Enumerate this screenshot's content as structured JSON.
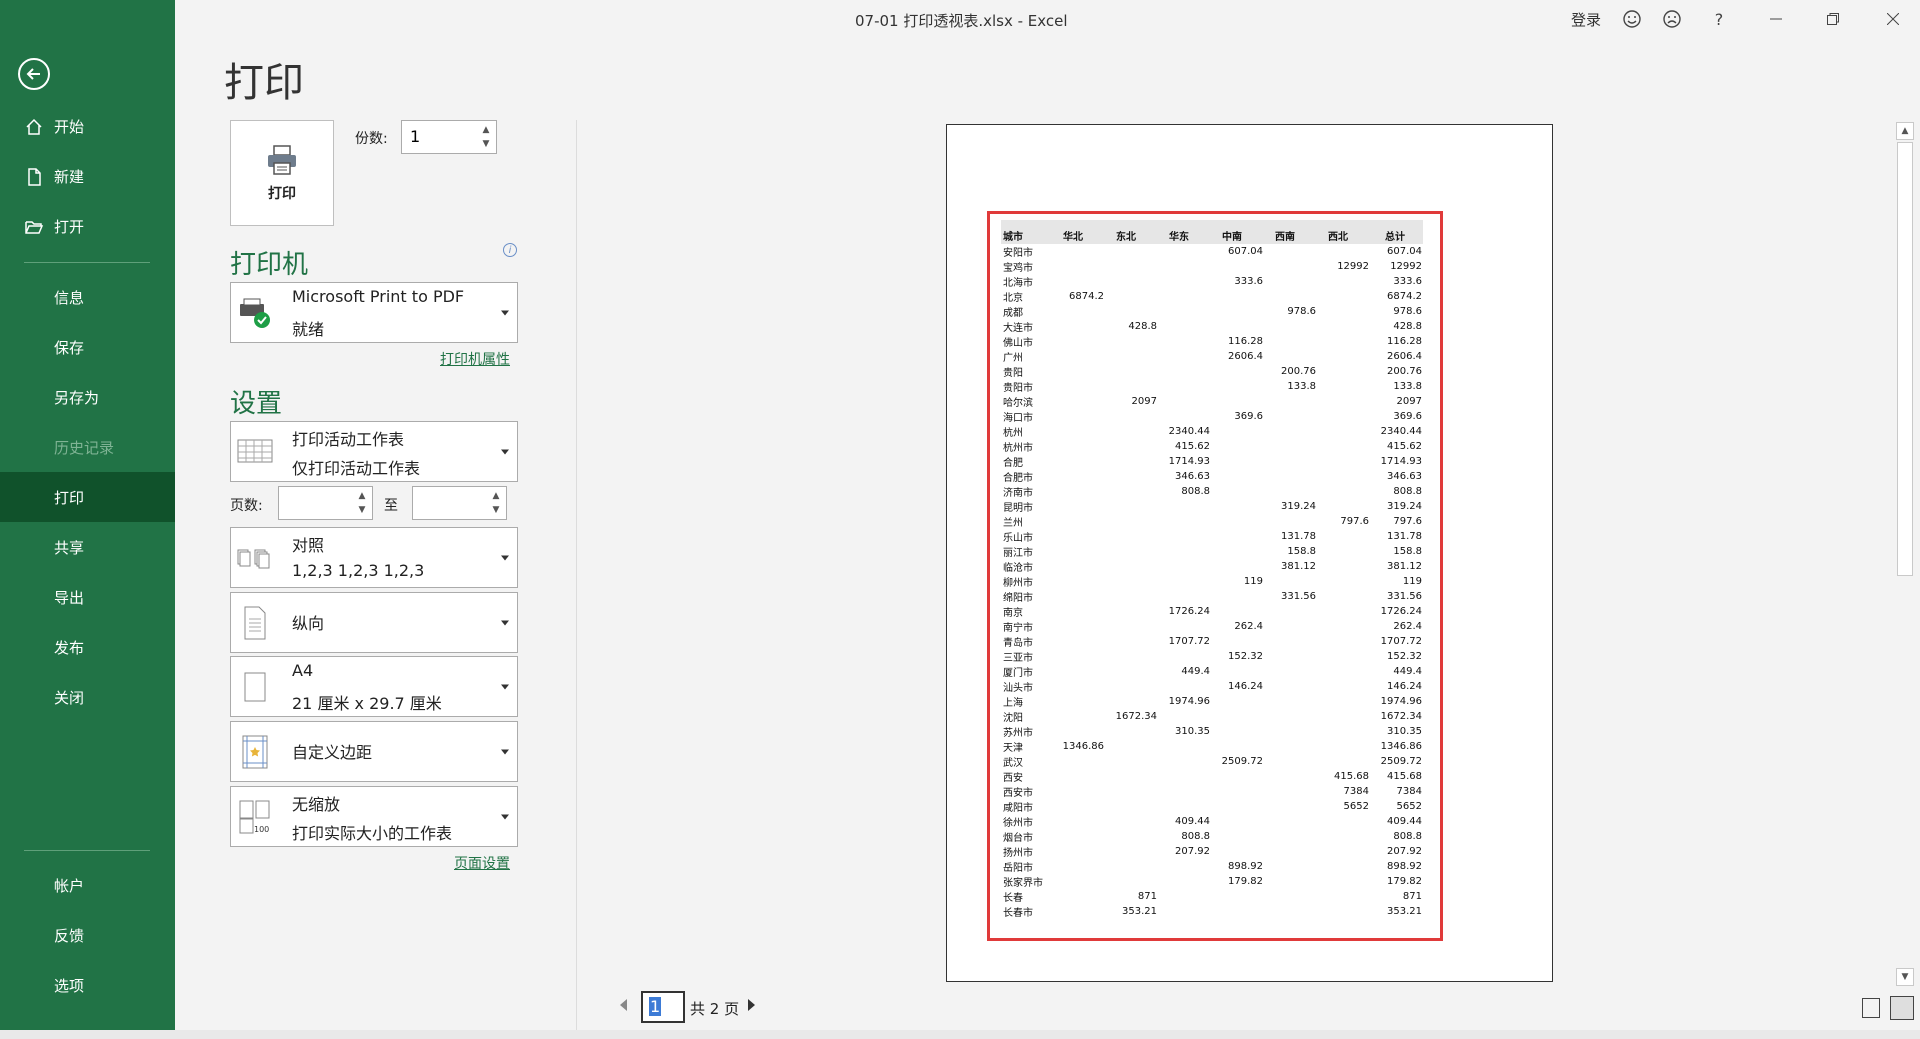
{
  "window": {
    "title": "07-01 打印透视表.xlsx  -  Excel",
    "login": "登录"
  },
  "nav": {
    "home": "开始",
    "new": "新建",
    "open": "打开",
    "info": "信息",
    "save": "保存",
    "saveas": "另存为",
    "history": "历史记录",
    "print": "打印",
    "share": "共享",
    "export": "导出",
    "publish": "发布",
    "close": "关闭",
    "account": "帐户",
    "feedback": "反馈",
    "options": "选项"
  },
  "print": {
    "heading": "打印",
    "button": "打印",
    "copies_label": "份数:",
    "copies_value": "1",
    "printer_section": "打印机",
    "printer_name": "Microsoft Print to PDF",
    "printer_status": "就绪",
    "printer_props": "打印机属性",
    "settings_section": "设置",
    "what": {
      "l1": "打印活动工作表",
      "l2": "仅打印活动工作表"
    },
    "pages_label": "页数:",
    "to_label": "至",
    "collate": {
      "l1": "对照",
      "l2": "1,2,3    1,2,3    1,2,3"
    },
    "orientation": "纵向",
    "paper": {
      "l1": "A4",
      "l2": "21 厘米 x 29.7 厘米"
    },
    "margins": "自定义边距",
    "scaling": {
      "l1": "无缩放",
      "l2": "打印实际大小的工作表"
    },
    "page_setup": "页面设置"
  },
  "pager": {
    "current": "1",
    "total": "共 2 页"
  },
  "colors": {
    "sidebar": "#217346",
    "active": "#10522b",
    "highlight": "#e03a3a"
  },
  "pivot": {
    "headers": [
      "城市",
      "华北",
      "东北",
      "华东",
      "中南",
      "西南",
      "西北",
      "总计"
    ],
    "rows": [
      [
        "安阳市",
        "",
        "",
        "",
        "607.04",
        "",
        "",
        "607.04"
      ],
      [
        "宝鸡市",
        "",
        "",
        "",
        "",
        "",
        "12992",
        "12992"
      ],
      [
        "北海市",
        "",
        "",
        "",
        "333.6",
        "",
        "",
        "333.6"
      ],
      [
        "北京",
        "6874.2",
        "",
        "",
        "",
        "",
        "",
        "6874.2"
      ],
      [
        "成都",
        "",
        "",
        "",
        "",
        "978.6",
        "",
        "978.6"
      ],
      [
        "大连市",
        "",
        "428.8",
        "",
        "",
        "",
        "",
        "428.8"
      ],
      [
        "佛山市",
        "",
        "",
        "",
        "116.28",
        "",
        "",
        "116.28"
      ],
      [
        "广州",
        "",
        "",
        "",
        "2606.4",
        "",
        "",
        "2606.4"
      ],
      [
        "贵阳",
        "",
        "",
        "",
        "",
        "200.76",
        "",
        "200.76"
      ],
      [
        "贵阳市",
        "",
        "",
        "",
        "",
        "133.8",
        "",
        "133.8"
      ],
      [
        "哈尔滨",
        "",
        "2097",
        "",
        "",
        "",
        "",
        "2097"
      ],
      [
        "海口市",
        "",
        "",
        "",
        "369.6",
        "",
        "",
        "369.6"
      ],
      [
        "杭州",
        "",
        "",
        "2340.44",
        "",
        "",
        "",
        "2340.44"
      ],
      [
        "杭州市",
        "",
        "",
        "415.62",
        "",
        "",
        "",
        "415.62"
      ],
      [
        "合肥",
        "",
        "",
        "1714.93",
        "",
        "",
        "",
        "1714.93"
      ],
      [
        "合肥市",
        "",
        "",
        "346.63",
        "",
        "",
        "",
        "346.63"
      ],
      [
        "济南市",
        "",
        "",
        "808.8",
        "",
        "",
        "",
        "808.8"
      ],
      [
        "昆明市",
        "",
        "",
        "",
        "",
        "319.24",
        "",
        "319.24"
      ],
      [
        "兰州",
        "",
        "",
        "",
        "",
        "",
        "797.6",
        "797.6"
      ],
      [
        "乐山市",
        "",
        "",
        "",
        "",
        "131.78",
        "",
        "131.78"
      ],
      [
        "丽江市",
        "",
        "",
        "",
        "",
        "158.8",
        "",
        "158.8"
      ],
      [
        "临沧市",
        "",
        "",
        "",
        "",
        "381.12",
        "",
        "381.12"
      ],
      [
        "柳州市",
        "",
        "",
        "",
        "119",
        "",
        "",
        "119"
      ],
      [
        "绵阳市",
        "",
        "",
        "",
        "",
        "331.56",
        "",
        "331.56"
      ],
      [
        "南京",
        "",
        "",
        "1726.24",
        "",
        "",
        "",
        "1726.24"
      ],
      [
        "南宁市",
        "",
        "",
        "",
        "262.4",
        "",
        "",
        "262.4"
      ],
      [
        "青岛市",
        "",
        "",
        "1707.72",
        "",
        "",
        "",
        "1707.72"
      ],
      [
        "三亚市",
        "",
        "",
        "",
        "152.32",
        "",
        "",
        "152.32"
      ],
      [
        "厦门市",
        "",
        "",
        "449.4",
        "",
        "",
        "",
        "449.4"
      ],
      [
        "汕头市",
        "",
        "",
        "",
        "146.24",
        "",
        "",
        "146.24"
      ],
      [
        "上海",
        "",
        "",
        "1974.96",
        "",
        "",
        "",
        "1974.96"
      ],
      [
        "沈阳",
        "",
        "1672.34",
        "",
        "",
        "",
        "",
        "1672.34"
      ],
      [
        "苏州市",
        "",
        "",
        "310.35",
        "",
        "",
        "",
        "310.35"
      ],
      [
        "天津",
        "1346.86",
        "",
        "",
        "",
        "",
        "",
        "1346.86"
      ],
      [
        "武汉",
        "",
        "",
        "",
        "2509.72",
        "",
        "",
        "2509.72"
      ],
      [
        "西安",
        "",
        "",
        "",
        "",
        "",
        "415.68",
        "415.68"
      ],
      [
        "西安市",
        "",
        "",
        "",
        "",
        "",
        "7384",
        "7384"
      ],
      [
        "咸阳市",
        "",
        "",
        "",
        "",
        "",
        "5652",
        "5652"
      ],
      [
        "徐州市",
        "",
        "",
        "409.44",
        "",
        "",
        "",
        "409.44"
      ],
      [
        "烟台市",
        "",
        "",
        "808.8",
        "",
        "",
        "",
        "808.8"
      ],
      [
        "扬州市",
        "",
        "",
        "207.92",
        "",
        "",
        "",
        "207.92"
      ],
      [
        "岳阳市",
        "",
        "",
        "",
        "898.92",
        "",
        "",
        "898.92"
      ],
      [
        "张家界市",
        "",
        "",
        "",
        "179.82",
        "",
        "",
        "179.82"
      ],
      [
        "长春",
        "",
        "871",
        "",
        "",
        "",
        "",
        "871"
      ],
      [
        "长春市",
        "",
        "353.21",
        "",
        "",
        "",
        "",
        "353.21"
      ]
    ]
  }
}
